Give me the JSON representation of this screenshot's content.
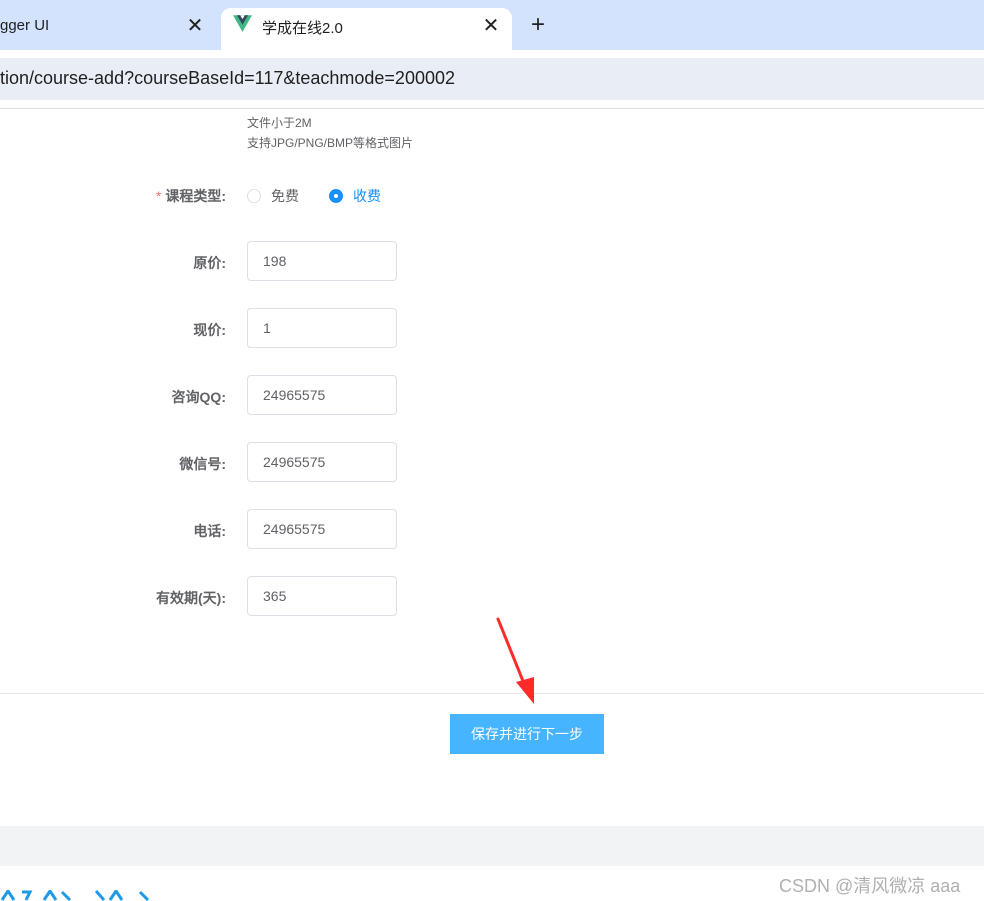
{
  "browser": {
    "tabs": [
      {
        "title": "gger UI",
        "active": false
      },
      {
        "title": "学成在线2.0",
        "active": true
      }
    ],
    "close_glyph": "✕",
    "new_tab_glyph": "+",
    "url": "tion/course-add?courseBaseId=117&teachmode=200002"
  },
  "upload_hints": [
    "文件小于2M",
    "支持JPG/PNG/BMP等格式图片"
  ],
  "course_type": {
    "label": "课程类型:",
    "required_mark": "*",
    "options": [
      {
        "label": "免费",
        "checked": false
      },
      {
        "label": "收费",
        "checked": true
      }
    ]
  },
  "fields": {
    "original_price": {
      "label": "原价:",
      "value": "198"
    },
    "current_price": {
      "label": "现价:",
      "value": "1"
    },
    "qq": {
      "label": "咨询QQ:",
      "value": "24965575"
    },
    "wechat": {
      "label": "微信号:",
      "value": "24965575"
    },
    "phone": {
      "label": "电话:",
      "value": "24965575"
    },
    "validity_days": {
      "label": "有效期(天):",
      "value": "365"
    }
  },
  "save_button": "保存并进行下一步",
  "watermark": "CSDN @清风微凉 aaa",
  "colors": {
    "primary": "#1890ff",
    "button": "#46b4ff",
    "required": "#f56c6c",
    "annotation_arrow": "#ff2a2a"
  },
  "icons": {
    "tab_favicon": "vue-logo-icon",
    "radio_unchecked": "radio-unchecked-icon",
    "radio_checked": "radio-checked-icon",
    "annotation": "red-arrow-icon"
  }
}
